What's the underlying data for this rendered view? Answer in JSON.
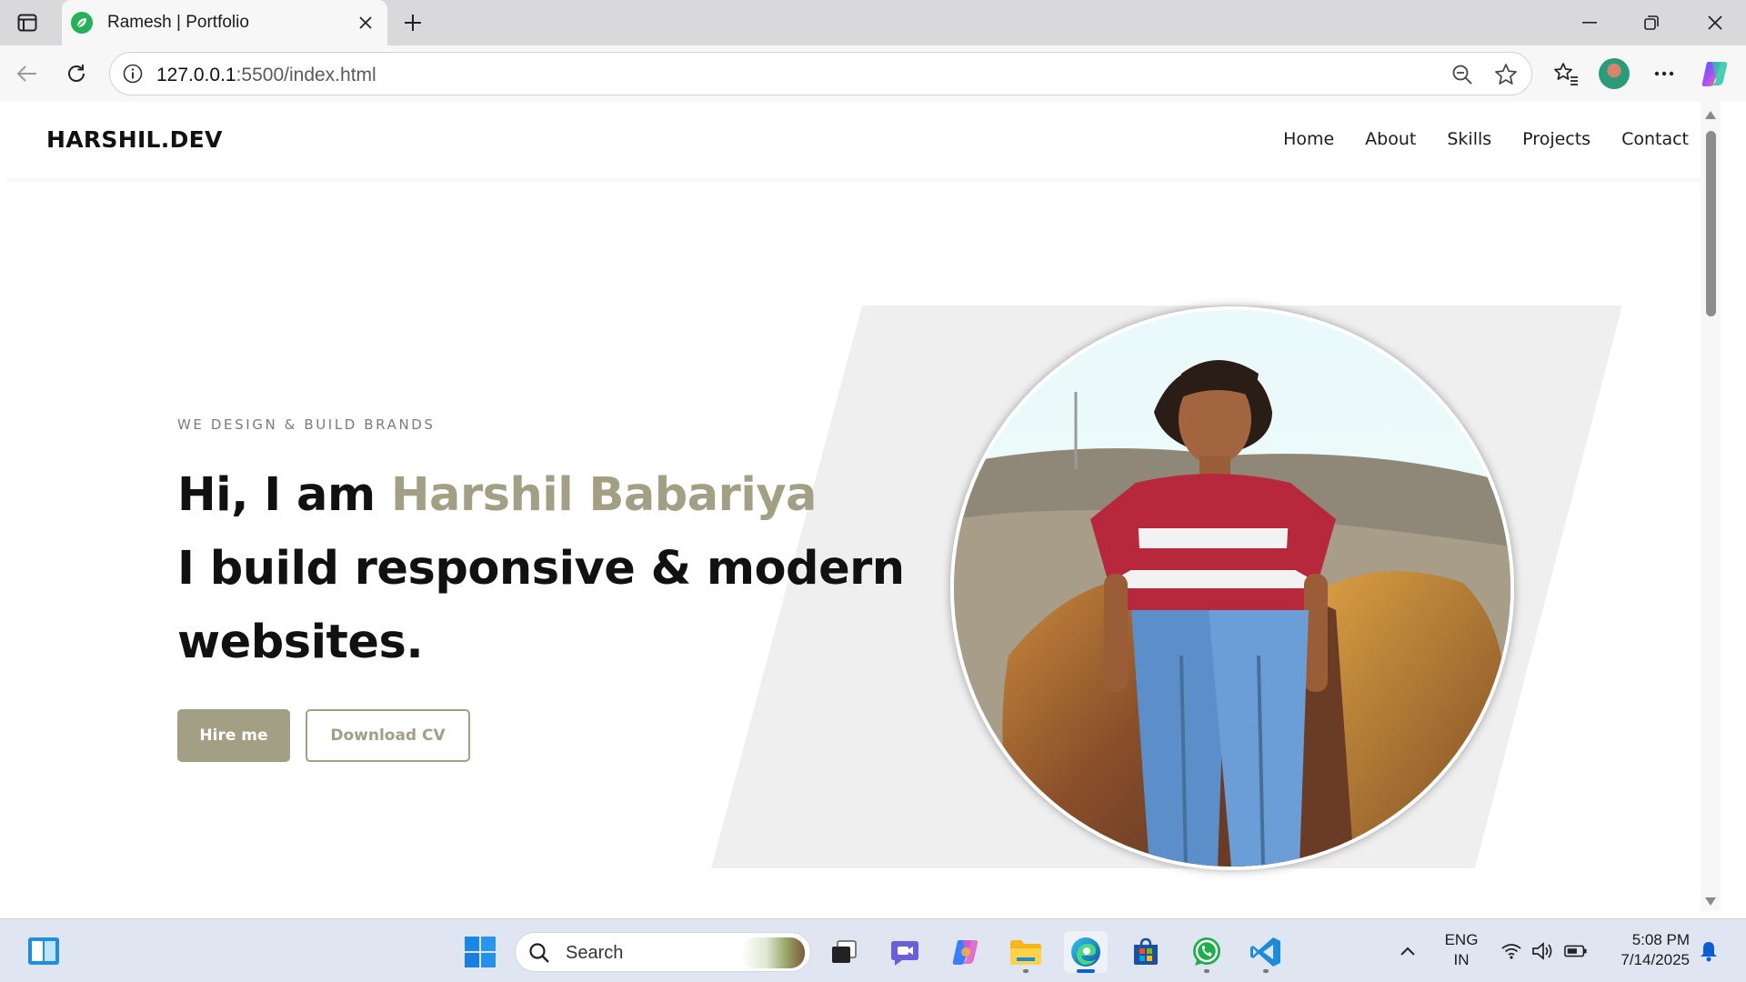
{
  "browser": {
    "tab_title": "Ramesh | Portfolio",
    "url_host": "127.0.0.1",
    "url_rest": ":5500/index.html"
  },
  "site": {
    "brand": "HARSHIL.DEV",
    "nav": [
      "Home",
      "About",
      "Skills",
      "Projects",
      "Contact"
    ],
    "hero": {
      "eyebrow": "WE DESIGN & BUILD BRANDS",
      "greeting": "Hi, I am ",
      "name": "Harshil Babariya",
      "line2": "I build responsive & modern",
      "line3": "websites.",
      "hire_label": "Hire me",
      "cv_label": "Download CV"
    }
  },
  "taskbar": {
    "search_label": "Search",
    "lang_line1": "ENG",
    "lang_line2": "IN",
    "time": "5:08 PM",
    "date": "7/14/2025"
  },
  "colors": {
    "accent": "#a29f84",
    "hero_shape": "#efefef",
    "edge_active": "#0a5fd6"
  },
  "icons": {
    "tab_favicon": "green-leaf-icon",
    "window_controls": [
      "minimize-icon",
      "restore-icon",
      "close-icon"
    ],
    "toolbar": [
      "back-arrow-icon",
      "refresh-icon",
      "info-icon",
      "zoom-out-icon",
      "star-icon",
      "favorites-icon",
      "profile-avatar",
      "more-icon",
      "copilot-icon"
    ],
    "taskbar_apps": [
      "windows-start-icon",
      "task-view-icon",
      "teams-chat-icon",
      "copilot-icon",
      "file-explorer-icon",
      "edge-icon",
      "microsoft-store-icon",
      "whatsapp-icon",
      "vscode-icon"
    ]
  }
}
